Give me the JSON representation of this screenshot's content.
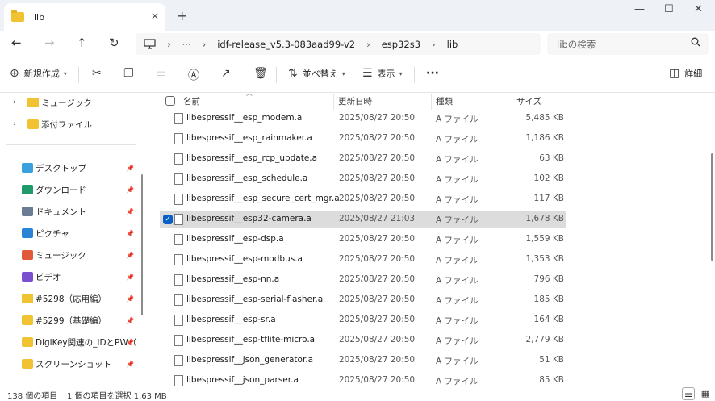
{
  "window": {
    "tab_title": "lib",
    "tab_close": "✕",
    "new_tab": "+",
    "minimize": "—",
    "maximize": "☐",
    "close": "✕"
  },
  "nav": {
    "back": "←",
    "forward": "→",
    "up": "↑",
    "refresh": "↻",
    "more": "···",
    "breadcrumb": [
      "idf-release_v5.3-083aad99-v2",
      "esp32s3",
      "lib"
    ],
    "breadcrumb_sep": "›",
    "search_placeholder": "libの検索"
  },
  "toolbar": {
    "new_label": "新規作成",
    "sort_label": "並べ替え",
    "view_label": "表示",
    "more": "···",
    "details_label": "詳細"
  },
  "sidebar": {
    "tree_items": [
      {
        "label": "ミュージック"
      },
      {
        "label": "添付ファイル"
      }
    ],
    "quick_items": [
      {
        "label": "デスクトップ",
        "icon": "desktop-icon",
        "color": "#3aa0e0"
      },
      {
        "label": "ダウンロード",
        "icon": "download-icon",
        "color": "#1f9a6b"
      },
      {
        "label": "ドキュメント",
        "icon": "document-icon",
        "color": "#6a7d94"
      },
      {
        "label": "ピクチャ",
        "icon": "pictures-icon",
        "color": "#2b83d8"
      },
      {
        "label": "ミュージック",
        "icon": "music-icon",
        "color": "#e05a3a"
      },
      {
        "label": "ビデオ",
        "icon": "video-icon",
        "color": "#7a4fd0"
      },
      {
        "label": "#5298（応用編）",
        "icon": "folder-icon",
        "color": "#f1c232"
      },
      {
        "label": "#5299（基礎編）",
        "icon": "folder-icon",
        "color": "#f1c232"
      },
      {
        "label": "DigiKey関連の_IDとPW（",
        "icon": "folder-icon",
        "color": "#f1c232"
      },
      {
        "label": "スクリーンショット",
        "icon": "folder-icon",
        "color": "#f1c232"
      }
    ]
  },
  "columns": {
    "name": "名前",
    "date": "更新日時",
    "type": "種類",
    "size": "サイズ"
  },
  "files": [
    {
      "name": "libespressif__esp_modem.a",
      "date": "2025/08/27 20:50",
      "type": "A ファイル",
      "size": "5,485 KB",
      "selected": false
    },
    {
      "name": "libespressif__esp_rainmaker.a",
      "date": "2025/08/27 20:50",
      "type": "A ファイル",
      "size": "1,186 KB",
      "selected": false
    },
    {
      "name": "libespressif__esp_rcp_update.a",
      "date": "2025/08/27 20:50",
      "type": "A ファイル",
      "size": "63 KB",
      "selected": false
    },
    {
      "name": "libespressif__esp_schedule.a",
      "date": "2025/08/27 20:50",
      "type": "A ファイル",
      "size": "102 KB",
      "selected": false
    },
    {
      "name": "libespressif__esp_secure_cert_mgr.a",
      "date": "2025/08/27 20:50",
      "type": "A ファイル",
      "size": "117 KB",
      "selected": false
    },
    {
      "name": "libespressif__esp32-camera.a",
      "date": "2025/08/27 21:03",
      "type": "A ファイル",
      "size": "1,678 KB",
      "selected": true
    },
    {
      "name": "libespressif__esp-dsp.a",
      "date": "2025/08/27 20:50",
      "type": "A ファイル",
      "size": "1,559 KB",
      "selected": false
    },
    {
      "name": "libespressif__esp-modbus.a",
      "date": "2025/08/27 20:50",
      "type": "A ファイル",
      "size": "1,353 KB",
      "selected": false
    },
    {
      "name": "libespressif__esp-nn.a",
      "date": "2025/08/27 20:50",
      "type": "A ファイル",
      "size": "796 KB",
      "selected": false
    },
    {
      "name": "libespressif__esp-serial-flasher.a",
      "date": "2025/08/27 20:50",
      "type": "A ファイル",
      "size": "185 KB",
      "selected": false
    },
    {
      "name": "libespressif__esp-sr.a",
      "date": "2025/08/27 20:50",
      "type": "A ファイル",
      "size": "164 KB",
      "selected": false
    },
    {
      "name": "libespressif__esp-tflite-micro.a",
      "date": "2025/08/27 20:50",
      "type": "A ファイル",
      "size": "2,779 KB",
      "selected": false
    },
    {
      "name": "libespressif__json_generator.a",
      "date": "2025/08/27 20:50",
      "type": "A ファイル",
      "size": "51 KB",
      "selected": false
    },
    {
      "name": "libespressif__json_parser.a",
      "date": "2025/08/27 20:50",
      "type": "A ファイル",
      "size": "85 KB",
      "selected": false
    }
  ],
  "status": {
    "item_count": "138 個の項目",
    "selection": "1 個の項目を選択  1.63 MB"
  },
  "colors": {
    "accent": "#0a5fc7",
    "titlebar_bg": "#eef1f6",
    "selected_row": "#dcdcdc"
  }
}
